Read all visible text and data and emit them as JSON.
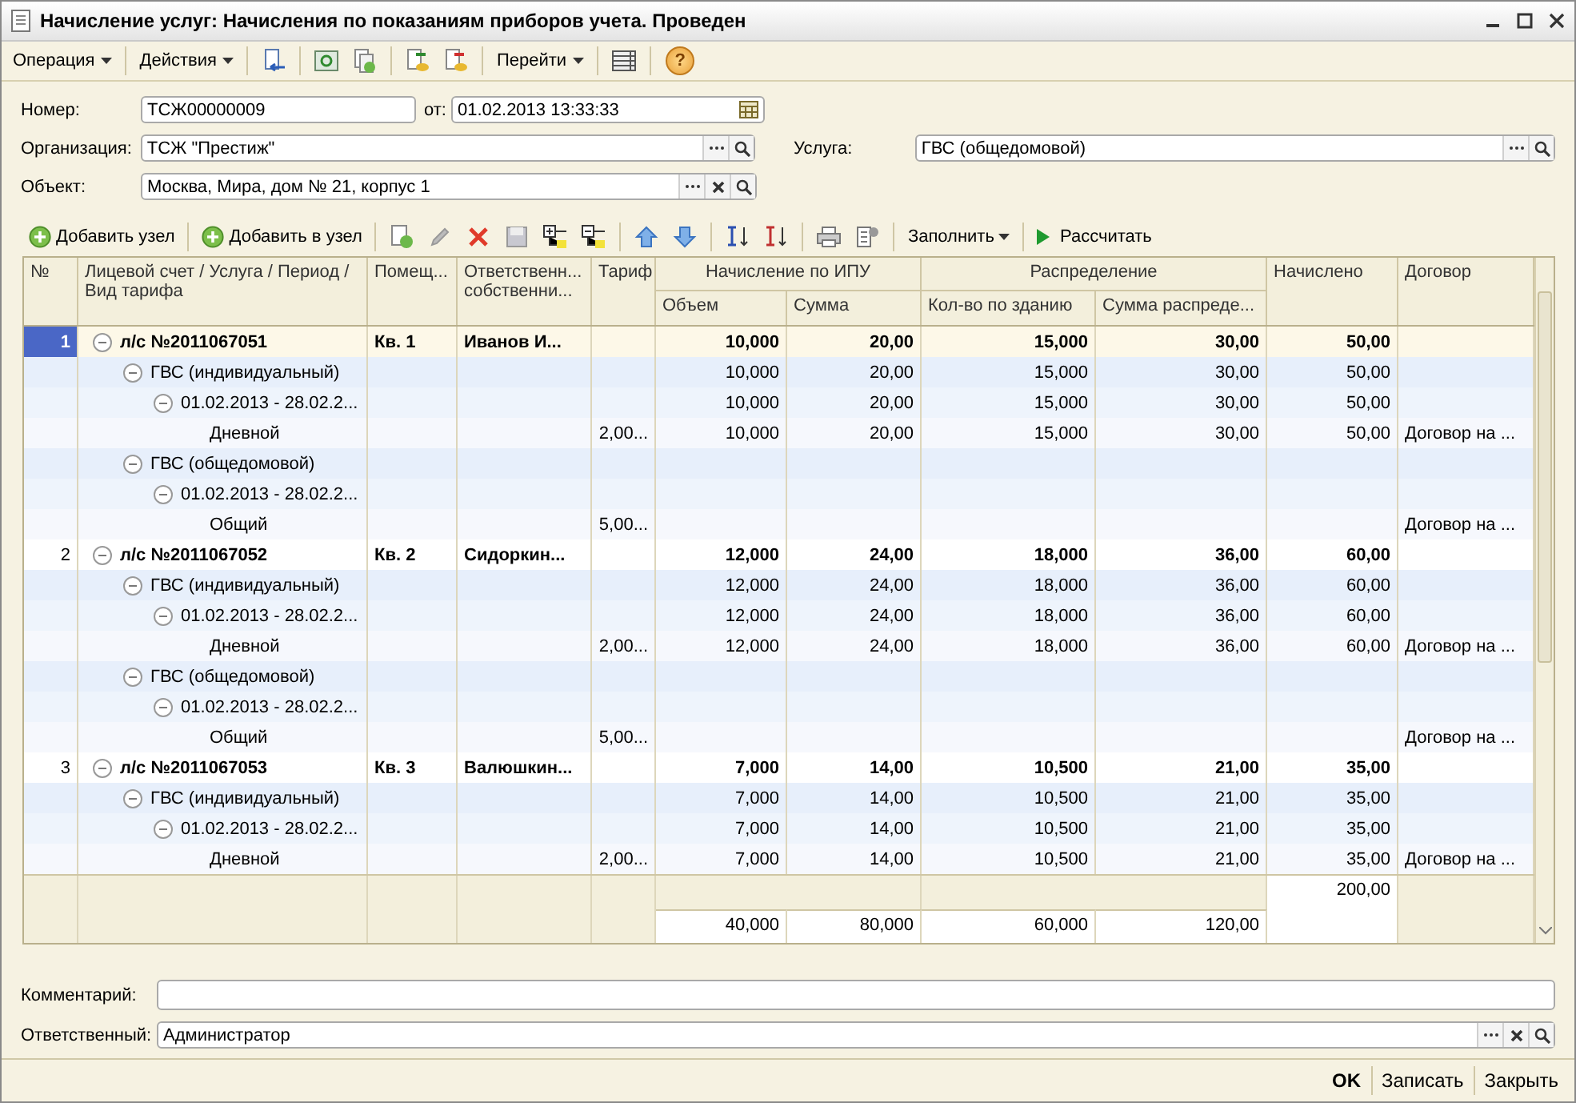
{
  "window": {
    "title": "Начисление услуг: Начисления по показаниям приборов учета. Проведен"
  },
  "toolbar": {
    "menus": [
      "Операция",
      "Действия",
      "Перейти"
    ],
    "help": "?"
  },
  "form": {
    "number": {
      "label": "Номер:",
      "value": "ТСЖ00000009"
    },
    "date": {
      "label": "от:",
      "value": "01.02.2013 13:33:33"
    },
    "organization": {
      "label": "Организация:",
      "value": "ТСЖ \"Престиж\""
    },
    "service": {
      "label": "Услуга:",
      "value": "ГВС (общедомовой)"
    },
    "object": {
      "label": "Объект:",
      "value": "Москва, Мира, дом № 21, корпус 1"
    }
  },
  "table_toolbar": {
    "add_node": "Добавить узел",
    "add_to_node": "Добавить в узел",
    "fill": "Заполнить",
    "calculate": "Рассчитать"
  },
  "table": {
    "columns": [
      "№",
      "Лицевой счет / Услуга / Период / Вид тарифа",
      "Помещ...",
      "Ответственн... собственни...",
      "Тариф"
    ],
    "groups": [
      {
        "label": "Начисление по ИПУ",
        "columns": [
          "Объем",
          "Сумма"
        ]
      },
      {
        "label": "Распределение",
        "columns": [
          "Кол-во по зданию",
          "Сумма распреде..."
        ]
      }
    ],
    "tail_columns": [
      "Начислено",
      "Договор"
    ],
    "rows": [
      {
        "num": "1",
        "name": "л/с №2011067051",
        "room": "Кв. 1",
        "owner": "Иванов И...",
        "volume": "10,000",
        "sum": "20,00",
        "qty": "15,000",
        "dist": "30,00",
        "accrued": "50,00",
        "selected": true,
        "expanded": true,
        "children": [
          {
            "name": "ГВС (индивидуальный)",
            "volume": "10,000",
            "sum": "20,00",
            "qty": "15,000",
            "dist": "30,00",
            "accrued": "50,00",
            "expanded": true,
            "children": [
              {
                "name": "01.02.2013 - 28.02.2...",
                "volume": "10,000",
                "sum": "20,00",
                "qty": "15,000",
                "dist": "30,00",
                "accrued": "50,00",
                "expanded": true,
                "children": [
                  {
                    "name": "Дневной",
                    "tariff": "2,00...",
                    "volume": "10,000",
                    "sum": "20,00",
                    "qty": "15,000",
                    "dist": "30,00",
                    "accrued": "50,00",
                    "contract": "Договор на ..."
                  }
                ]
              }
            ]
          },
          {
            "name": "ГВС (общедомовой)",
            "expanded": true,
            "children": [
              {
                "name": "01.02.2013 - 28.02.2...",
                "expanded": true,
                "children": [
                  {
                    "name": "Общий",
                    "tariff": "5,00...",
                    "contract": "Договор на ..."
                  }
                ]
              }
            ]
          }
        ]
      },
      {
        "num": "2",
        "name": "л/с №2011067052",
        "room": "Кв. 2",
        "owner": "Сидоркин...",
        "volume": "12,000",
        "sum": "24,00",
        "qty": "18,000",
        "dist": "36,00",
        "accrued": "60,00",
        "selected": false,
        "expanded": true,
        "children": [
          {
            "name": "ГВС (индивидуальный)",
            "volume": "12,000",
            "sum": "24,00",
            "qty": "18,000",
            "dist": "36,00",
            "accrued": "60,00",
            "expanded": true,
            "children": [
              {
                "name": "01.02.2013 - 28.02.2...",
                "volume": "12,000",
                "sum": "24,00",
                "qty": "18,000",
                "dist": "36,00",
                "accrued": "60,00",
                "expanded": true,
                "children": [
                  {
                    "name": "Дневной",
                    "tariff": "2,00...",
                    "volume": "12,000",
                    "sum": "24,00",
                    "qty": "18,000",
                    "dist": "36,00",
                    "accrued": "60,00",
                    "contract": "Договор на ..."
                  }
                ]
              }
            ]
          },
          {
            "name": "ГВС (общедомовой)",
            "expanded": true,
            "children": [
              {
                "name": "01.02.2013 - 28.02.2...",
                "expanded": true,
                "children": [
                  {
                    "name": "Общий",
                    "tariff": "5,00...",
                    "contract": "Договор на ..."
                  }
                ]
              }
            ]
          }
        ]
      },
      {
        "num": "3",
        "name": "л/с №2011067053",
        "room": "Кв. 3",
        "owner": "Валюшкин...",
        "volume": "7,000",
        "sum": "14,00",
        "qty": "10,500",
        "dist": "21,00",
        "accrued": "35,00",
        "selected": false,
        "expanded": true,
        "children": [
          {
            "name": "ГВС (индивидуальный)",
            "volume": "7,000",
            "sum": "14,00",
            "qty": "10,500",
            "dist": "21,00",
            "accrued": "35,00",
            "expanded": true,
            "children": [
              {
                "name": "01.02.2013 - 28.02.2...",
                "volume": "7,000",
                "sum": "14,00",
                "qty": "10,500",
                "dist": "21,00",
                "accrued": "35,00",
                "expanded": true,
                "children": [
                  {
                    "name": "Дневной",
                    "tariff": "2,00...",
                    "volume": "7,000",
                    "sum": "14,00",
                    "qty": "10,500",
                    "dist": "21,00",
                    "accrued": "35,00",
                    "contract": "Договор на ..."
                  }
                ]
              }
            ]
          }
        ]
      }
    ],
    "totals": {
      "accrued": "200,00",
      "volume": "40,000",
      "sum": "80,000",
      "qty": "60,000",
      "dist": "120,00"
    }
  },
  "footer": {
    "comment": {
      "label": "Комментарий:"
    },
    "responsible": {
      "label": "Ответственный:",
      "value": "Администратор"
    }
  },
  "buttons": [
    {
      "label": "OK",
      "default": true
    },
    {
      "label": "Записать",
      "default": false
    },
    {
      "label": "Закрыть",
      "default": false
    }
  ]
}
